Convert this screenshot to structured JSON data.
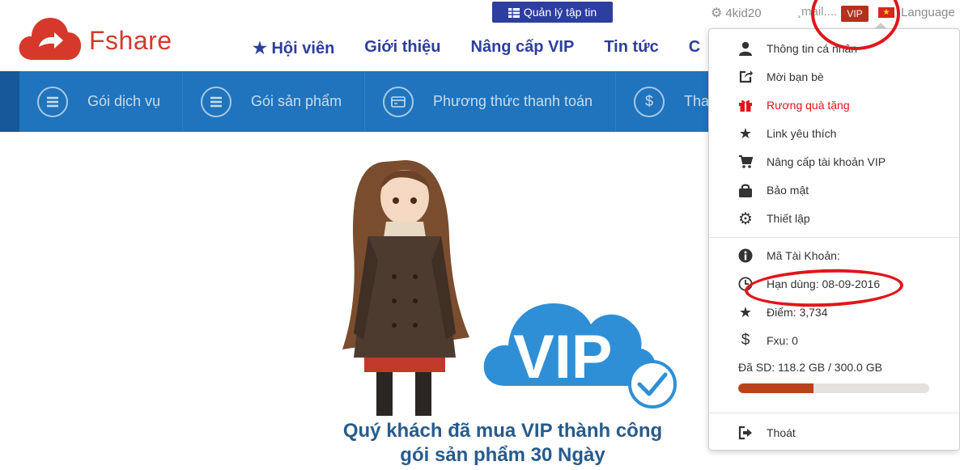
{
  "brand": {
    "name": "Fshare",
    "color": "#d6392b"
  },
  "header": {
    "file_manager_button": "Quản lý tập tin",
    "username": "4kid20",
    "email_partial": "¸mail....",
    "vip_badge": "VIP",
    "language": "Language"
  },
  "main_nav": [
    "★ Hội viên",
    "Giới thiệu",
    "Nâng cấp VIP",
    "Tin tức",
    "C"
  ],
  "sub_nav": [
    {
      "label": "Gói dịch vụ",
      "icon": "list-icon"
    },
    {
      "label": "Gói sản phẩm",
      "icon": "list-icon"
    },
    {
      "label": "Phương thức thanh toán",
      "icon": "card-icon"
    },
    {
      "label": "Tha",
      "icon": "dollar-icon"
    }
  ],
  "vip_logo_text": "VIP",
  "success_message": {
    "line1": "Quý khách đã mua VIP thành công",
    "line2": "gói sản phẩm 30 Ngày"
  },
  "dropdown": {
    "items": [
      {
        "label": "Thông tin cá nhân",
        "icon": "user-icon",
        "color": "#333333"
      },
      {
        "label": "Mời bạn bè",
        "icon": "share-icon",
        "color": "#333333"
      },
      {
        "label": "Rương quà tặng",
        "icon": "gift-icon",
        "color": "#e0161b"
      },
      {
        "label": "Link yêu thích",
        "icon": "star-icon",
        "color": "#333333"
      },
      {
        "label": "Nâng cấp tài khoản VIP",
        "icon": "cart-icon",
        "color": "#333333"
      },
      {
        "label": "Bảo mật",
        "icon": "lock-icon",
        "color": "#333333"
      },
      {
        "label": "Thiết lập",
        "icon": "gear-icon",
        "color": "#333333"
      }
    ],
    "account": {
      "id_label": "Mã Tài Khoản:",
      "expiry": "Hạn dùng: 08-09-2016",
      "points": "Điểm: 3,734",
      "fxu": "Fxu: 0"
    },
    "usage": {
      "label": "Đã SD: 118.2 GB / 300.0 GB",
      "fraction": 0.394
    },
    "logout": "Thoát"
  },
  "colors": {
    "nav_blue": "#2d3e9e",
    "subnav_blue": "#1f74bd",
    "vip_red": "#b3321d",
    "annotation_red": "#e0161b",
    "progress_fill": "#b9441b"
  }
}
